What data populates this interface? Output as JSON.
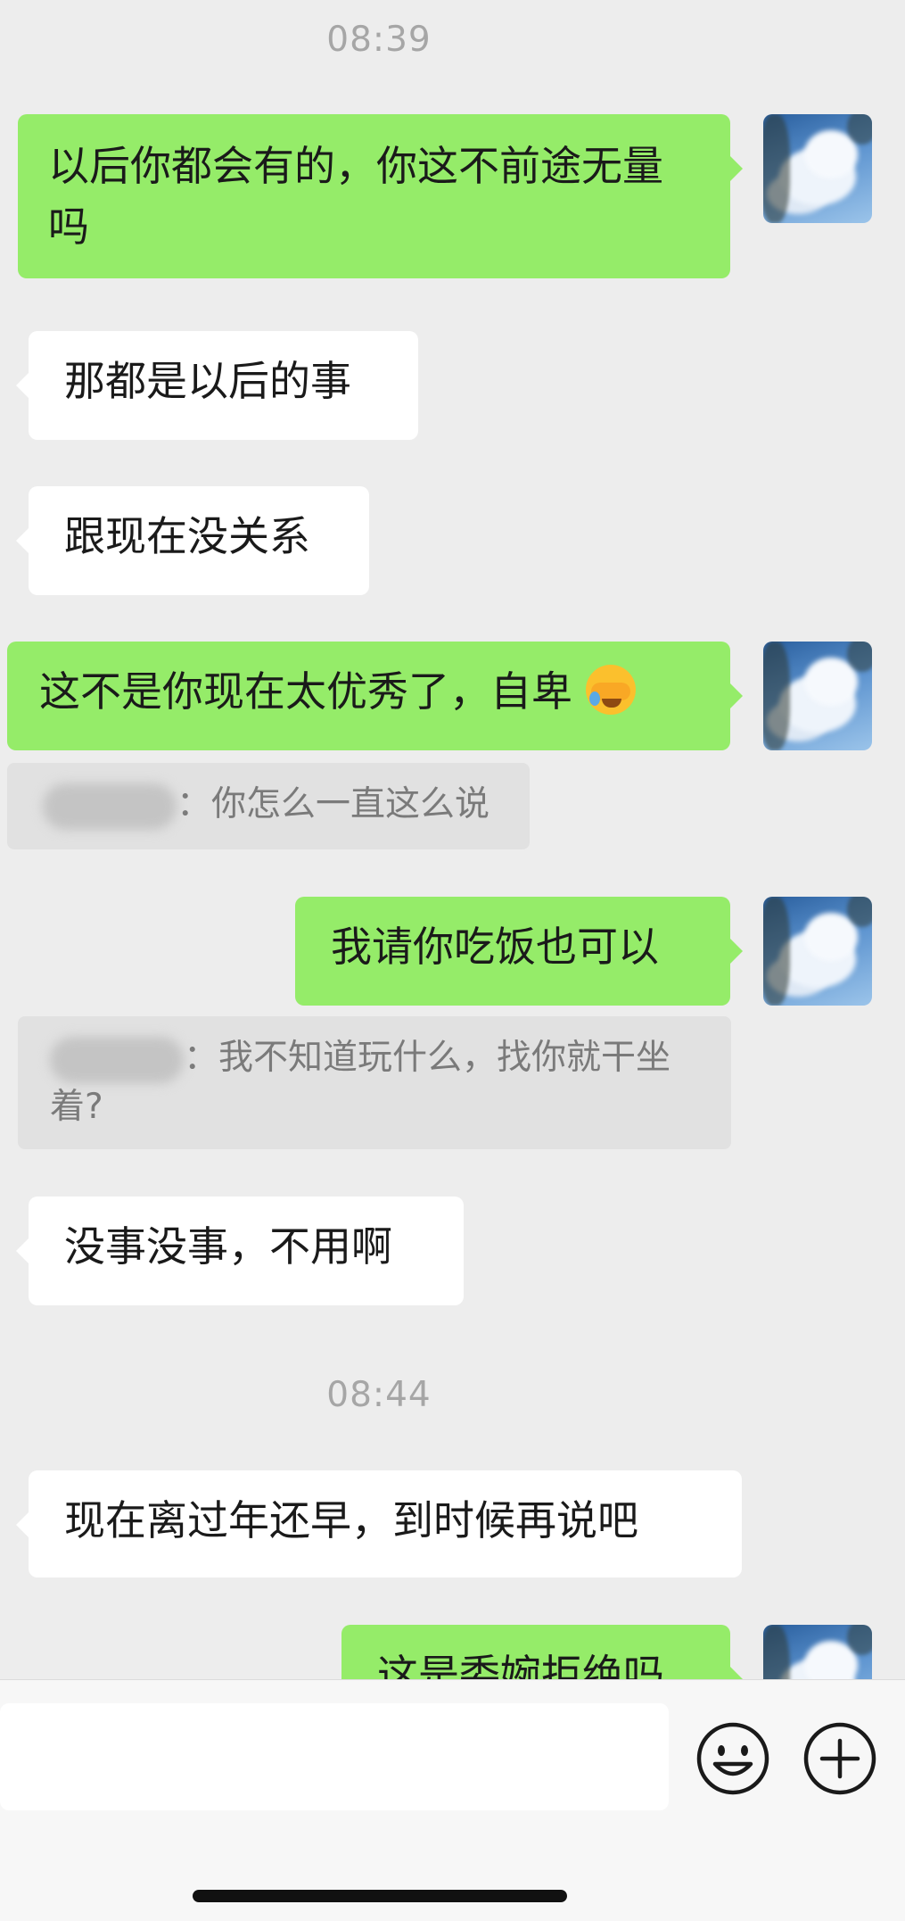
{
  "timestamps": [
    "08:39",
    "08:44"
  ],
  "messages": {
    "m1": {
      "side": "out",
      "text": "以后你都会有的，你这不前途无量吗"
    },
    "m2": {
      "side": "in",
      "text": "那都是以后的事"
    },
    "m3": {
      "side": "in",
      "text": "跟现在没关系"
    },
    "m4": {
      "side": "out",
      "text": "这不是你现在太优秀了，自卑",
      "emoji": "face-with-tears-of-joy"
    },
    "q1": {
      "type": "quote",
      "text": "：你怎么一直这么说"
    },
    "m5": {
      "side": "out",
      "text": "我请你吃饭也可以"
    },
    "q2": {
      "type": "quote",
      "text": "：我不知道玩什么，找你就干坐着?"
    },
    "m6": {
      "side": "in",
      "text": "没事没事，不用啊"
    },
    "m7": {
      "side": "in",
      "text": "现在离过年还早，到时候再说吧"
    },
    "m8": {
      "side": "out",
      "text": "这是委婉拒绝吗"
    }
  },
  "input": {
    "placeholder": ""
  },
  "icons": {
    "emoji_button": "smiley-face-icon",
    "more_button": "plus-circle-icon"
  },
  "colors": {
    "background": "#ededed",
    "outgoing_bubble": "#95ec69",
    "incoming_bubble": "#ffffff",
    "quote_bg": "#e1e1e1"
  }
}
